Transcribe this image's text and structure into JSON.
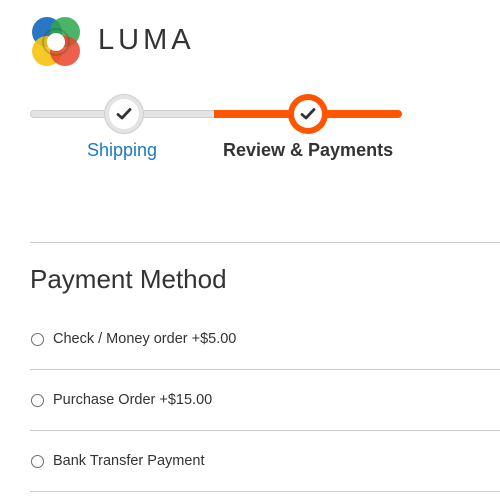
{
  "brand": {
    "name": "LUMA",
    "logo_colors": [
      "#1e6fc2",
      "#2aa84a",
      "#f5c30f",
      "#e8452c"
    ]
  },
  "progress": {
    "steps": [
      {
        "label": "Shipping",
        "state": "complete"
      },
      {
        "label": "Review & Payments",
        "state": "active"
      }
    ],
    "active_color": "#ff5501",
    "link_color": "#1979c3"
  },
  "payment": {
    "title": "Payment Method",
    "options": [
      {
        "label": "Check / Money order +$5.00",
        "selected": false
      },
      {
        "label": "Purchase Order +$15.00",
        "selected": false
      },
      {
        "label": "Bank Transfer Payment",
        "selected": false
      }
    ]
  }
}
